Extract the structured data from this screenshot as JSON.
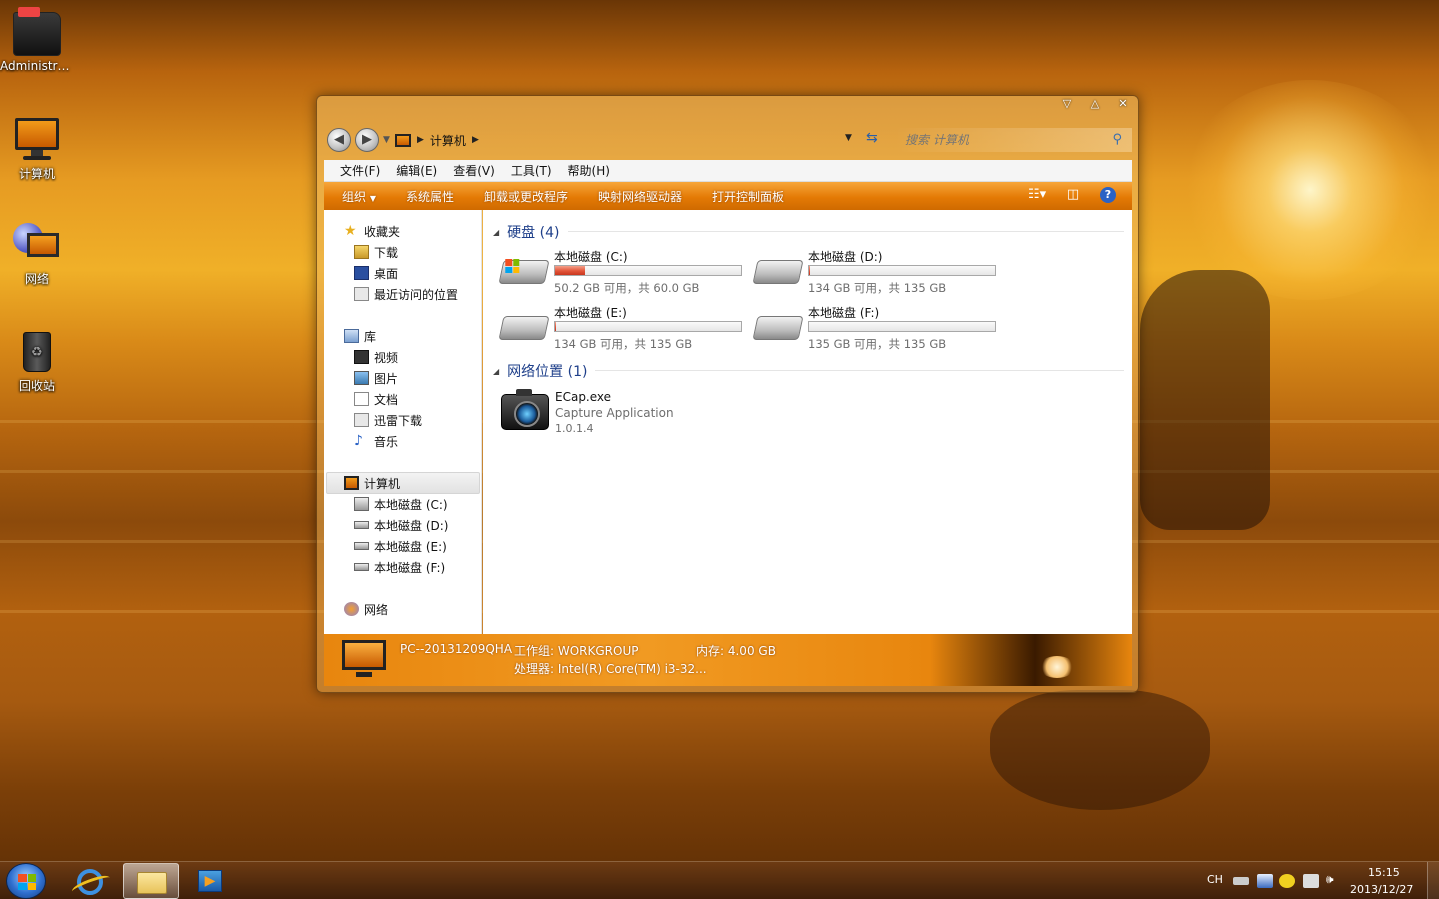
{
  "desktop": {
    "icons": [
      {
        "label": "Administra..."
      },
      {
        "label": "计算机"
      },
      {
        "label": "网络"
      },
      {
        "label": "回收站"
      }
    ]
  },
  "window": {
    "breadcrumb": [
      "计算机"
    ],
    "search_placeholder": "搜索 计算机",
    "menu": [
      "文件(F)",
      "编辑(E)",
      "查看(V)",
      "工具(T)",
      "帮助(H)"
    ],
    "toolbar": {
      "organize": "组织",
      "items": [
        "系统属性",
        "卸载或更改程序",
        "映射网络驱动器",
        "打开控制面板"
      ]
    },
    "nav": {
      "favorites": {
        "label": "收藏夹",
        "items": [
          "下载",
          "桌面",
          "最近访问的位置"
        ]
      },
      "libraries": {
        "label": "库",
        "items": [
          "视频",
          "图片",
          "文档",
          "迅雷下载",
          "音乐"
        ]
      },
      "computer": {
        "label": "计算机",
        "items": [
          "本地磁盘 (C:)",
          "本地磁盘 (D:)",
          "本地磁盘 (E:)",
          "本地磁盘 (F:)"
        ]
      },
      "network": {
        "label": "网络"
      }
    },
    "groups": {
      "hard_disks": {
        "header": "硬盘 (4)",
        "drives": [
          {
            "name": "本地磁盘 (C:)",
            "free": "50.2 GB 可用，共 60.0 GB",
            "used_fraction": 0.163
          },
          {
            "name": "本地磁盘 (D:)",
            "free": "134 GB 可用，共 135 GB",
            "used_fraction": 0.007
          },
          {
            "name": "本地磁盘 (E:)",
            "free": "134 GB 可用，共 135 GB",
            "used_fraction": 0.007
          },
          {
            "name": "本地磁盘 (F:)",
            "free": "135 GB 可用，共 135 GB",
            "used_fraction": 0.0
          }
        ]
      },
      "network_locations": {
        "header": "网络位置 (1)",
        "apps": [
          {
            "name": "ECap.exe",
            "description": "Capture Application",
            "version": "1.0.1.4"
          }
        ]
      }
    },
    "details": {
      "computer_name": "PC--20131209QHA",
      "workgroup": "工作组: WORKGROUP",
      "memory": "内存: 4.00 GB",
      "processor": "处理器: Intel(R) Core(TM) i3-32..."
    }
  },
  "taskbar": {
    "tray": {
      "lang": "CH",
      "time": "15:15",
      "date": "2013/12/27"
    }
  },
  "colors": {
    "toolbar_orange": "#e47a05",
    "group_header_blue": "#1e3f8a",
    "drive_bar_red": "#e2553a"
  }
}
